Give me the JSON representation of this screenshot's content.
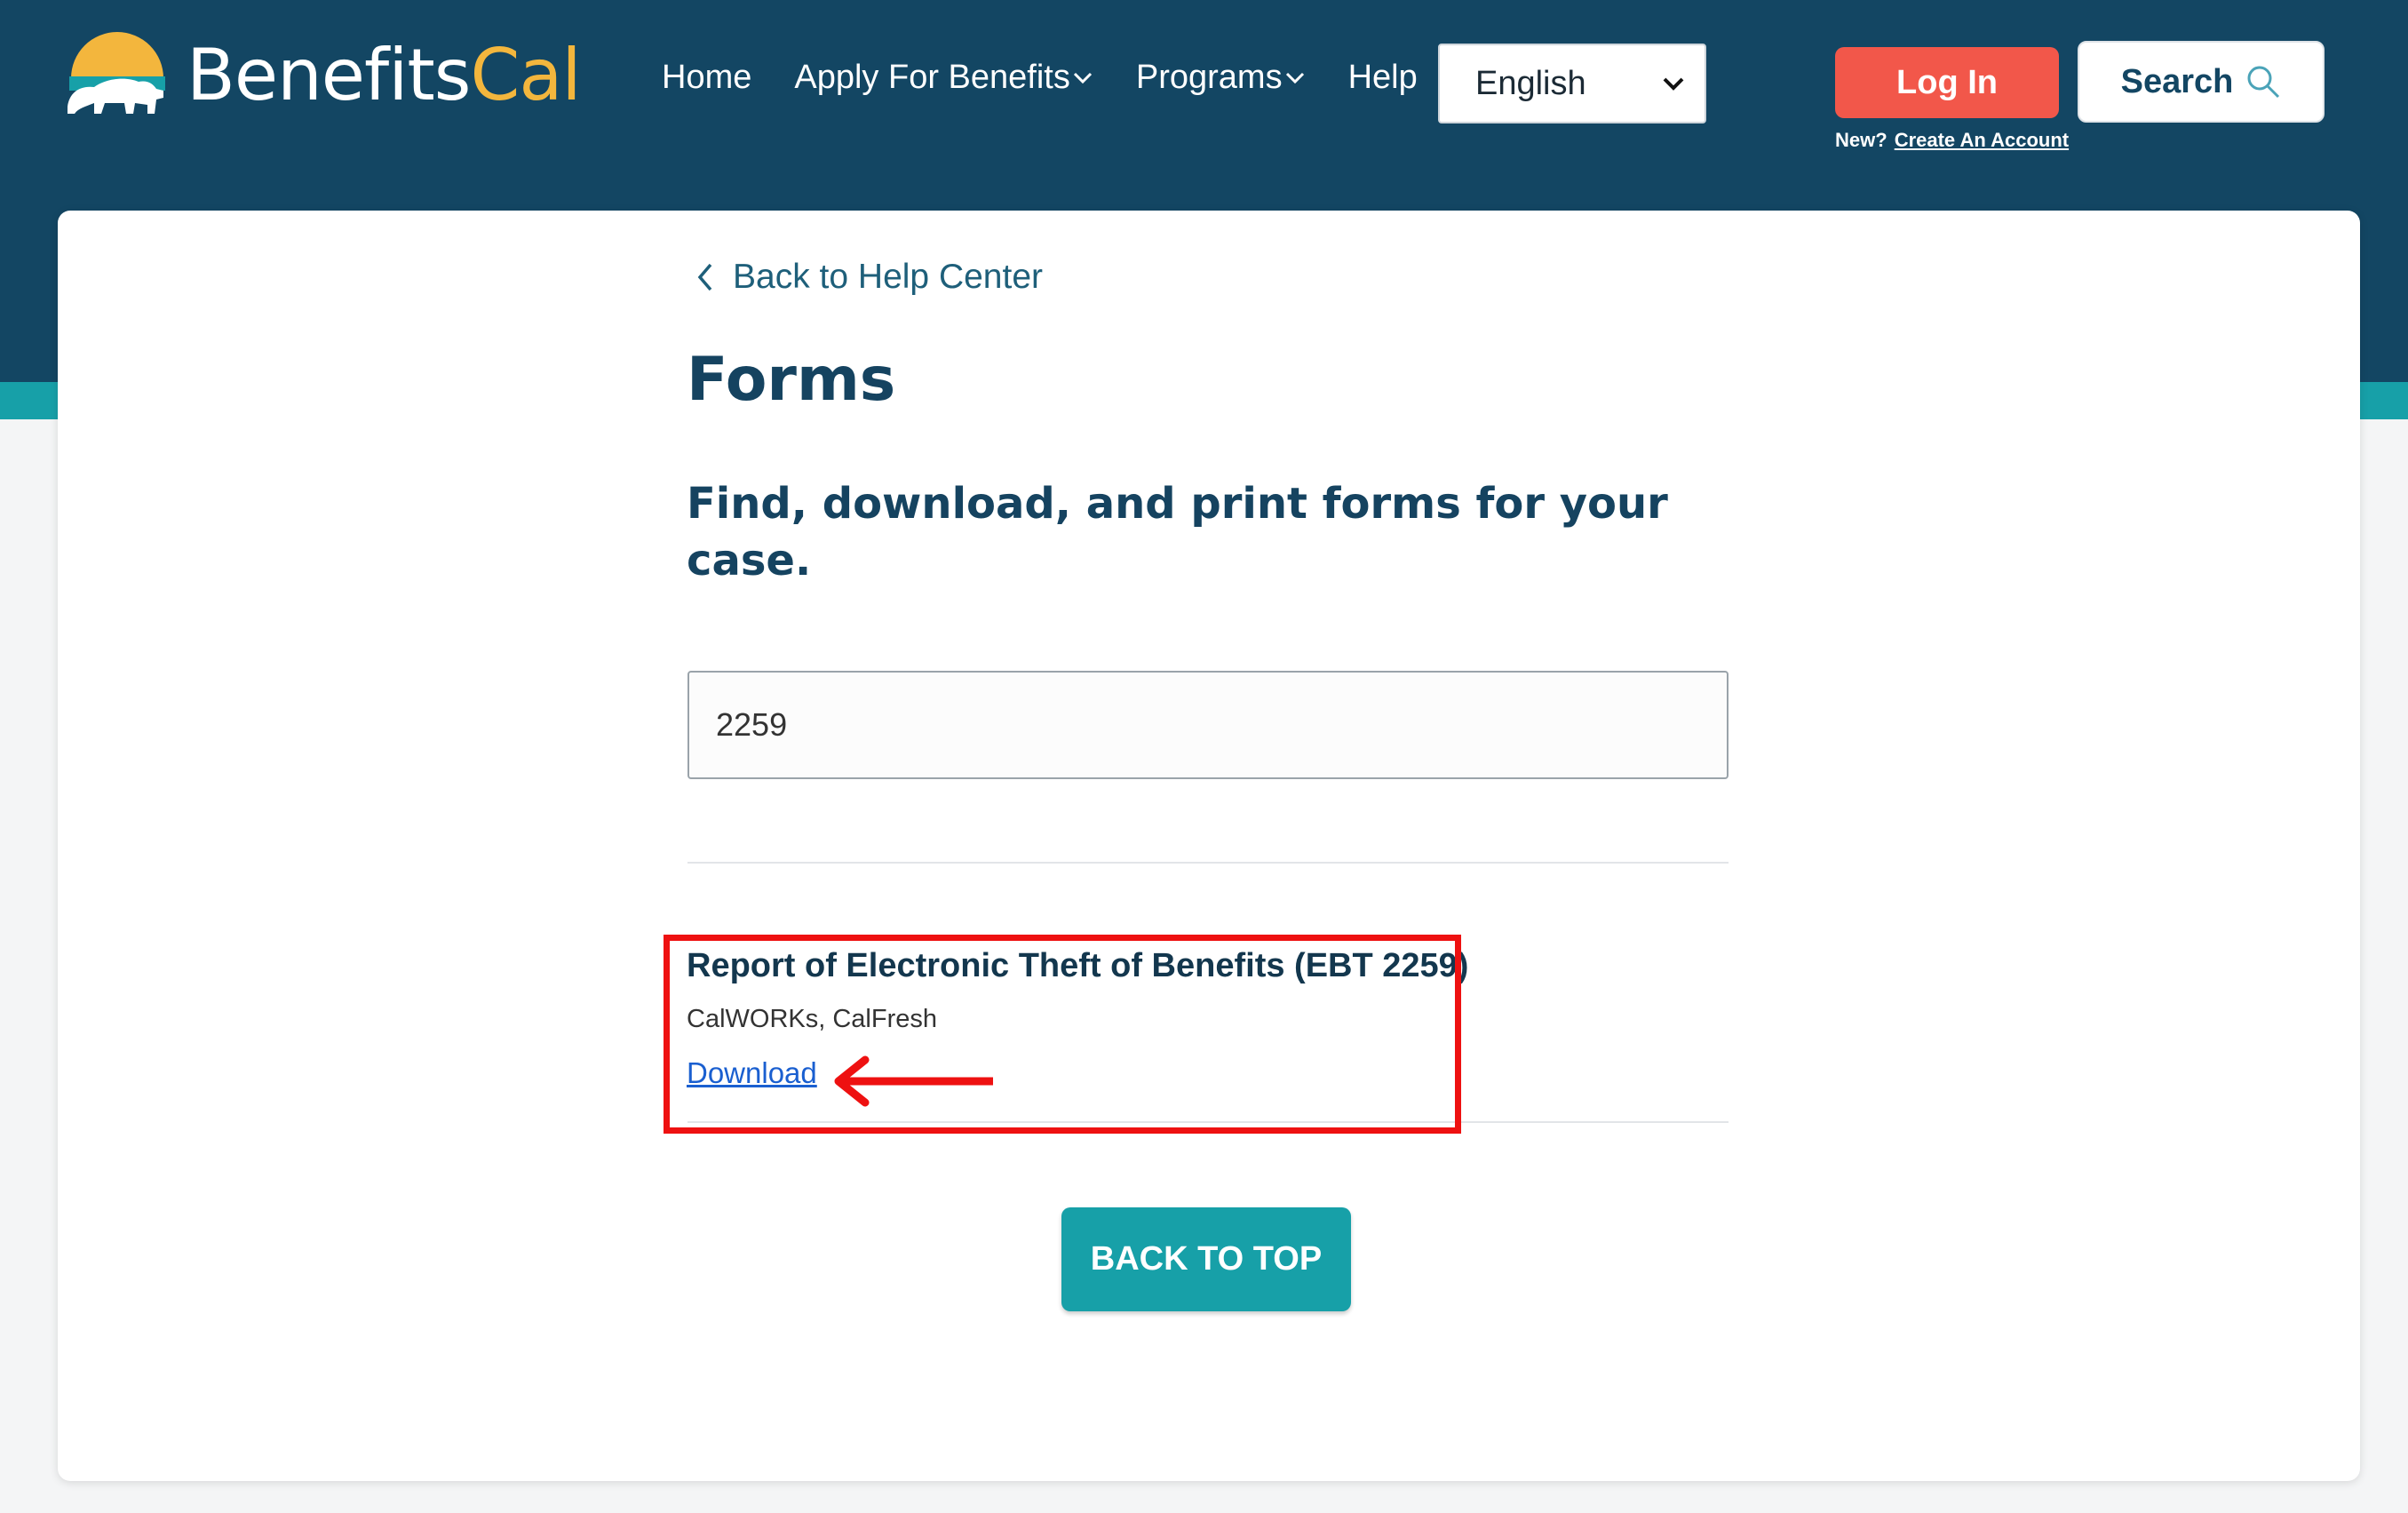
{
  "header": {
    "logo": {
      "text_part1": "Benefits",
      "text_part2": "Cal"
    },
    "nav": [
      {
        "label": "Home",
        "has_dropdown": false
      },
      {
        "label": "Apply For Benefits",
        "has_dropdown": true
      },
      {
        "label": "Programs",
        "has_dropdown": true
      },
      {
        "label": "Help",
        "has_dropdown": false
      }
    ],
    "language": {
      "selected": "English"
    },
    "login": {
      "label": "Log In",
      "new_text": "New?",
      "create_account": "Create An Account"
    },
    "search": {
      "label": "Search",
      "icon": "search-icon"
    }
  },
  "main": {
    "back_link": "Back to Help Center",
    "title": "Forms",
    "subtitle": "Find, download, and print forms for your case.",
    "search_value": "2259",
    "results": [
      {
        "title": "Report of Electronic Theft of Benefits (EBT 2259)",
        "programs": "CalWORKs, CalFresh",
        "download_label": "Download"
      }
    ],
    "back_to_top": "BACK TO TOP"
  },
  "colors": {
    "header_bg": "#134663",
    "teal": "#17a0a8",
    "login_red": "#f2574a",
    "logo_yellow": "#f3b63d",
    "annotation_red": "#ee1111",
    "link_blue": "#1a5fd0"
  }
}
